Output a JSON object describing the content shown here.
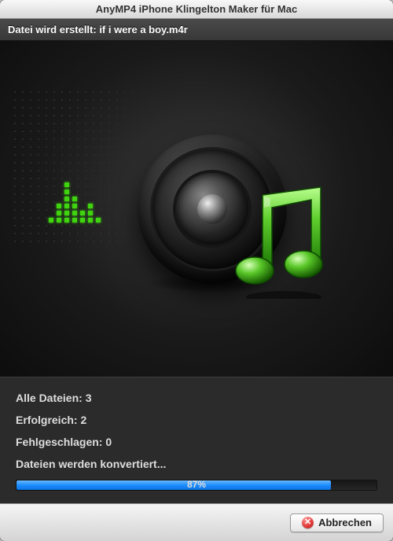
{
  "window": {
    "title": "AnyMP4 iPhone Klingelton Maker für Mac"
  },
  "status": {
    "creating_prefix": "Datei wird erstellt: ",
    "filename": "if i were a boy.m4r"
  },
  "icons": {
    "speaker": "speaker-icon",
    "music_note": "music-note-icon",
    "equalizer": "equalizer-icon",
    "cancel_x": "✕"
  },
  "info": {
    "all_files_label": "Alle Dateien:",
    "all_files_value": "3",
    "success_label": "Erfolgreich:",
    "success_value": "2",
    "failed_label": "Fehlgeschlagen:",
    "failed_value": "0",
    "converting_label": "Dateien werden konvertiert..."
  },
  "progress": {
    "percent": 87,
    "percent_label": "87%"
  },
  "footer": {
    "cancel_label": "Abbrechen"
  }
}
